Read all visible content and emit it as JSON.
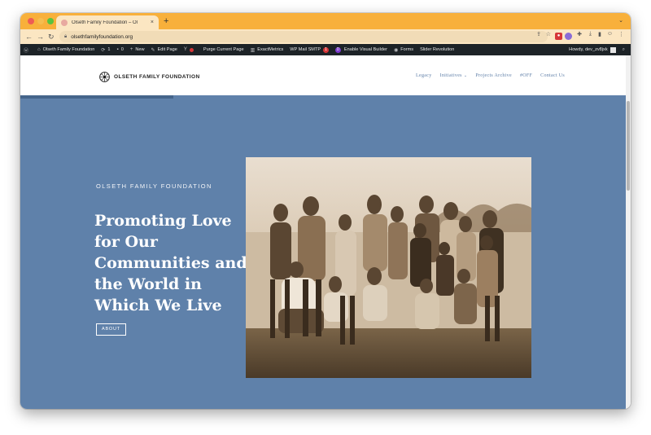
{
  "browser": {
    "tab_title": "Olseth Family Foundation – Ol",
    "tab_close": "×",
    "new_tab": "+",
    "tab_menu": "⌄",
    "url": "olsethfamilyfoundation.org",
    "tab_color": "#f8b03b"
  },
  "adminbar": {
    "site_name": "Olseth Family Foundation",
    "updates_count": "1",
    "comments_count": "0",
    "new_label": "New",
    "edit_label": "Edit Page",
    "purge_label": "Purge Current Page",
    "exactmetrics_label": "ExactMetrics",
    "wpmail_label": "WP Mail SMTP",
    "wpmail_badge": "1",
    "visual_builder_label": "Enable Visual Builder",
    "forms_label": "Forms",
    "slider_label": "Slider Revolution",
    "howdy": "Howdy, dev_zv8jxk"
  },
  "site": {
    "logo_text": "OLSETH FAMILY FOUNDATION",
    "nav": [
      {
        "label": "Legacy"
      },
      {
        "label": "Initiatives"
      },
      {
        "label": "Projects Archive"
      },
      {
        "label": "#OFF"
      },
      {
        "label": "Contact Us"
      }
    ],
    "nav_caret": "⌄"
  },
  "hero": {
    "kicker": "OLSETH FAMILY FOUNDATION",
    "heading": "Promoting Love for Our Communities and the World in Which We Live",
    "button": "ABOUT",
    "background": "#5f81aa"
  }
}
